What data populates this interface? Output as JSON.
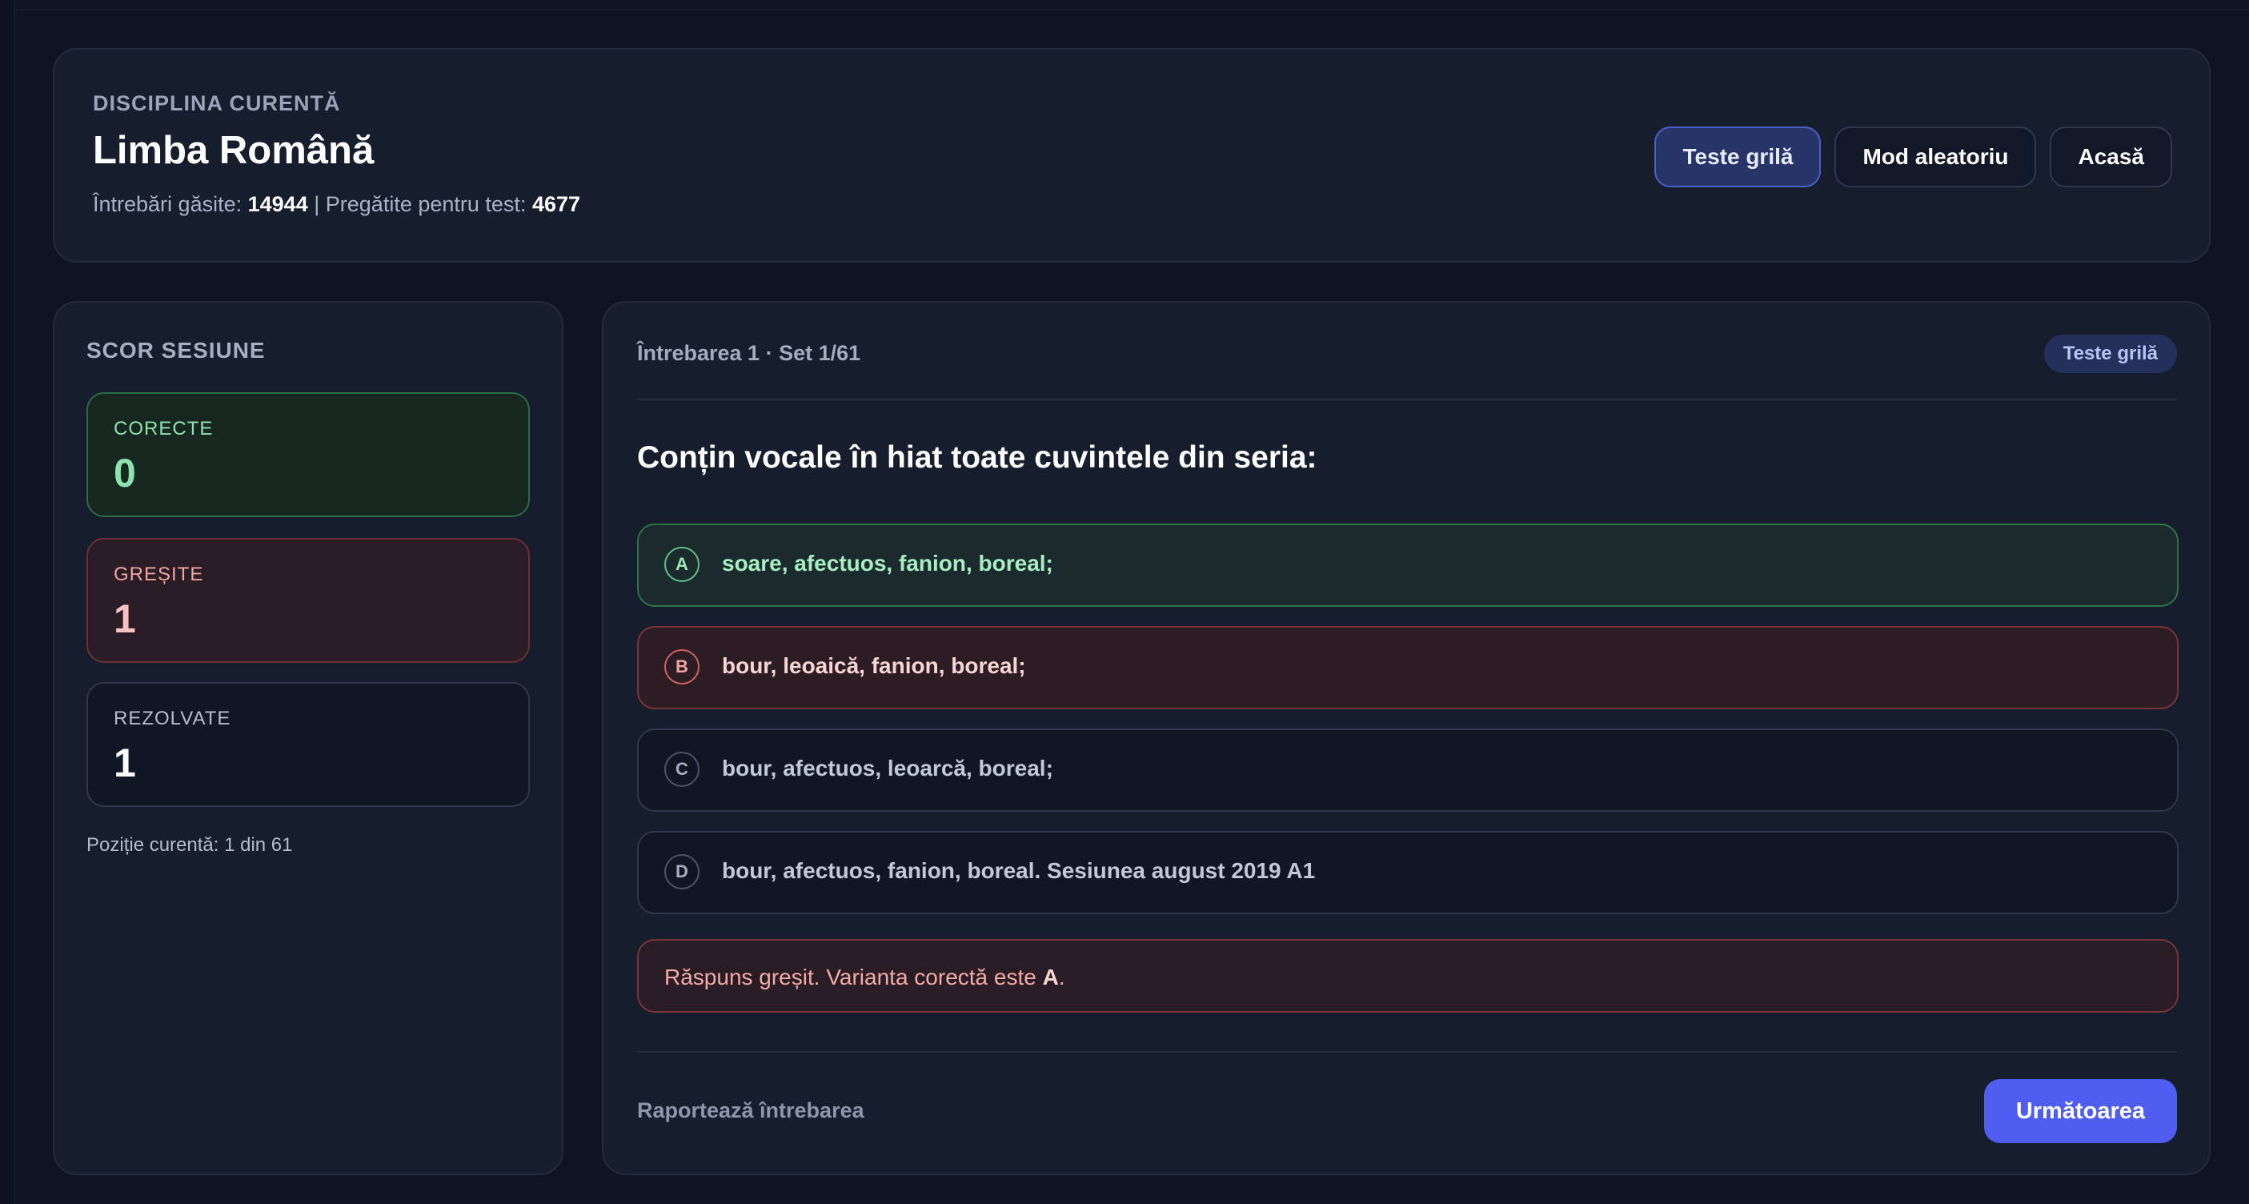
{
  "header": {
    "eyebrow": "DISCIPLINA CURENTĂ",
    "title": "Limba Română",
    "stats": {
      "found_label": "Întrebări găsite:",
      "found_value": "14944",
      "separator": "|",
      "ready_label": "Pregătite pentru test:",
      "ready_value": "4677"
    },
    "buttons": {
      "grid_tests": "Teste grilă",
      "random_mode": "Mod aleatoriu",
      "home": "Acasă"
    },
    "active_button": "grid_tests"
  },
  "score": {
    "title": "SCOR SESIUNE",
    "correct": {
      "label": "CORECTE",
      "value": "0"
    },
    "wrong": {
      "label": "GREȘITE",
      "value": "1"
    },
    "solved": {
      "label": "REZOLVATE",
      "value": "1"
    },
    "position": "Poziție curentă: 1 din 61"
  },
  "question": {
    "meta": "Întrebarea 1 · Set 1/61",
    "badge": "Teste grilă",
    "text": "Conțin vocale în hiat toate cuvintele din seria:",
    "options": [
      {
        "letter": "A",
        "text": "soare, afectuos, fanion, boreal;",
        "state": "correct"
      },
      {
        "letter": "B",
        "text": "bour, leoaică, fanion, boreal;",
        "state": "wrong-selected"
      },
      {
        "letter": "C",
        "text": "bour, afectuos, leoarcă, boreal;",
        "state": "neutral"
      },
      {
        "letter": "D",
        "text": "bour, afectuos, fanion, boreal. Sesiunea august 2019 A1",
        "state": "neutral"
      }
    ],
    "feedback": {
      "text": "Răspuns greșit. Varianta corectă este",
      "answer": "A",
      "end": "."
    }
  },
  "footer": {
    "report": "Raportează întrebarea",
    "next": "Următoarea"
  },
  "colors": {
    "background": "#0f1422",
    "card": "#161d2c",
    "accent": "#4f5df0",
    "correct": "#2f7448",
    "wrong": "#7a3338"
  }
}
